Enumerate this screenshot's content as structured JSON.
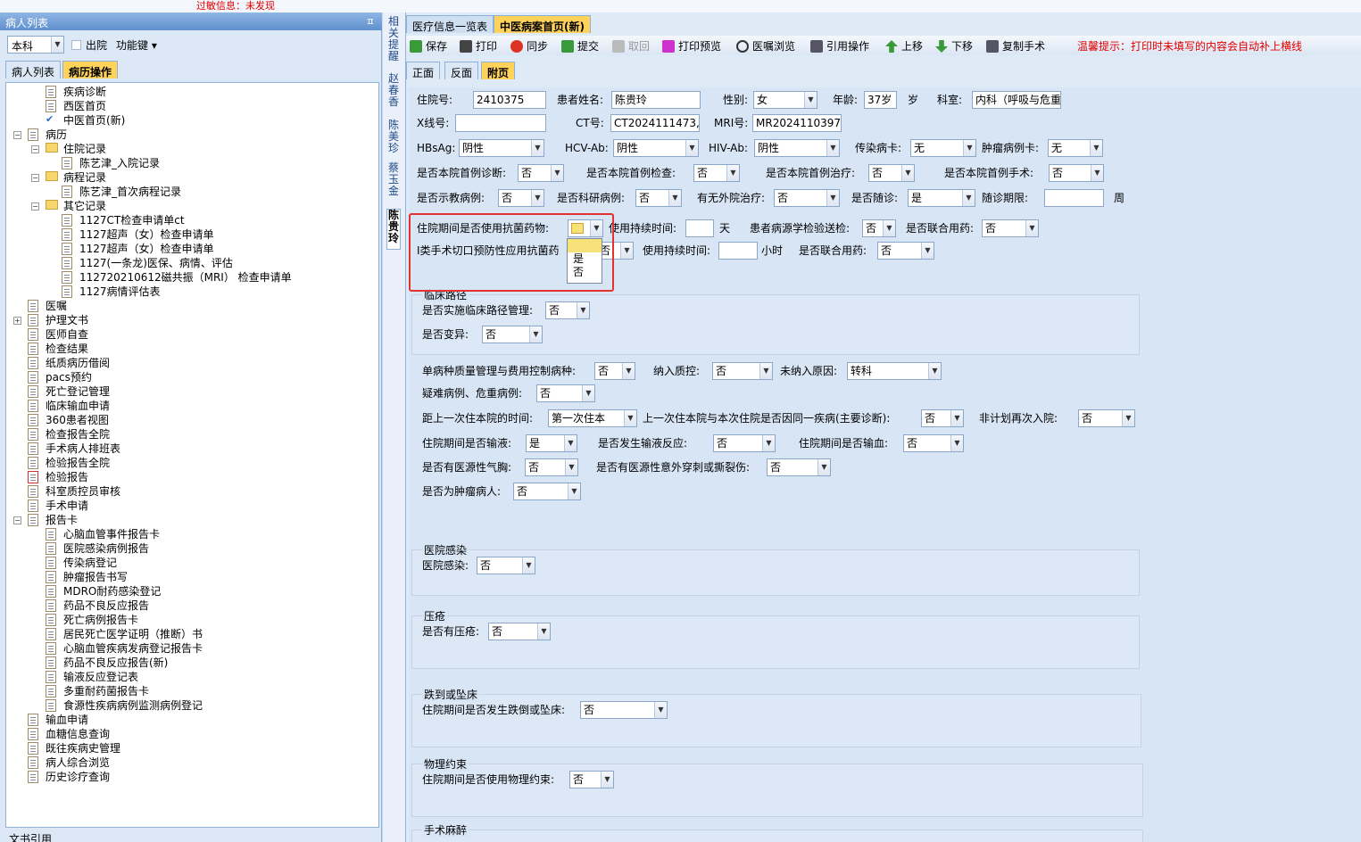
{
  "allergy": "过敏信息：未发现",
  "left": {
    "title": "病人列表",
    "pin": "ㅍ",
    "dept": "本科",
    "discharge": "出院",
    "func": "功能键 ▾",
    "tabs": [
      "病人列表",
      "病历操作"
    ],
    "tree": [
      {
        "t": "疾病诊断",
        "l": 1,
        "i": "doc"
      },
      {
        "t": "西医首页",
        "l": 1,
        "i": "doc"
      },
      {
        "t": "中医首页(新)",
        "l": 1,
        "i": "check"
      },
      {
        "t": "病历",
        "l": 0,
        "i": "doc",
        "e": "−"
      },
      {
        "t": "住院记录",
        "l": 1,
        "i": "fold",
        "e": "−"
      },
      {
        "t": "陈艺津_入院记录",
        "l": 2,
        "i": "doc"
      },
      {
        "t": "病程记录",
        "l": 1,
        "i": "fold",
        "e": "−"
      },
      {
        "t": "陈艺津_首次病程记录",
        "l": 2,
        "i": "doc"
      },
      {
        "t": "其它记录",
        "l": 1,
        "i": "fold",
        "e": "−"
      },
      {
        "t": "1127CT检查申请单ct",
        "l": 2,
        "i": "doc"
      },
      {
        "t": "1127超声（女）检查申请单",
        "l": 2,
        "i": "doc"
      },
      {
        "t": "1127超声（女）检查申请单",
        "l": 2,
        "i": "doc"
      },
      {
        "t": "1127(一条龙)医保、病情、评估",
        "l": 2,
        "i": "doc"
      },
      {
        "t": "112720210612磁共振（MRI） 检查申请单",
        "l": 2,
        "i": "doc"
      },
      {
        "t": "1127病情评估表",
        "l": 2,
        "i": "doc"
      },
      {
        "t": "医嘱",
        "l": 0,
        "i": "doc"
      },
      {
        "t": "护理文书",
        "l": 0,
        "i": "doc",
        "e": "+"
      },
      {
        "t": "医师自查",
        "l": 0,
        "i": "doc"
      },
      {
        "t": "检查结果",
        "l": 0,
        "i": "doc"
      },
      {
        "t": "纸质病历借阅",
        "l": 0,
        "i": "doc"
      },
      {
        "t": "pacs预约",
        "l": 0,
        "i": "doc"
      },
      {
        "t": "死亡登记管理",
        "l": 0,
        "i": "doc"
      },
      {
        "t": "临床输血申请",
        "l": 0,
        "i": "doc"
      },
      {
        "t": "360患者视图",
        "l": 0,
        "i": "doc"
      },
      {
        "t": "检查报告全院",
        "l": 0,
        "i": "doc"
      },
      {
        "t": "手术病人排班表",
        "l": 0,
        "i": "doc"
      },
      {
        "t": "检验报告全院",
        "l": 0,
        "i": "doc"
      },
      {
        "t": "检验报告",
        "l": 0,
        "i": "red"
      },
      {
        "t": "科室质控员审核",
        "l": 0,
        "i": "doc"
      },
      {
        "t": "手术申请",
        "l": 0,
        "i": "doc"
      },
      {
        "t": "报告卡",
        "l": 0,
        "i": "doc",
        "e": "−"
      },
      {
        "t": "心脑血管事件报告卡",
        "l": 1,
        "i": "doc"
      },
      {
        "t": "医院感染病例报告",
        "l": 1,
        "i": "doc"
      },
      {
        "t": "传染病登记",
        "l": 1,
        "i": "doc"
      },
      {
        "t": "肿瘤报告书写",
        "l": 1,
        "i": "doc"
      },
      {
        "t": "MDRO耐药感染登记",
        "l": 1,
        "i": "doc"
      },
      {
        "t": "药品不良反应报告",
        "l": 1,
        "i": "doc"
      },
      {
        "t": "死亡病例报告卡",
        "l": 1,
        "i": "doc"
      },
      {
        "t": "居民死亡医学证明（推断）书",
        "l": 1,
        "i": "doc"
      },
      {
        "t": "心脑血管疾病发病登记报告卡",
        "l": 1,
        "i": "doc"
      },
      {
        "t": "药品不良反应报告(新)",
        "l": 1,
        "i": "doc"
      },
      {
        "t": "输液反应登记表",
        "l": 1,
        "i": "doc"
      },
      {
        "t": "多重耐药菌报告卡",
        "l": 1,
        "i": "doc"
      },
      {
        "t": "食源性疾病病例监测病例登记",
        "l": 1,
        "i": "doc"
      },
      {
        "t": "输血申请",
        "l": 0,
        "i": "doc"
      },
      {
        "t": "血糖信息查询",
        "l": 0,
        "i": "doc"
      },
      {
        "t": "既往疾病史管理",
        "l": 0,
        "i": "doc"
      },
      {
        "t": "病人综合浏览",
        "l": 0,
        "i": "doc"
      },
      {
        "t": "历史诊疗查询",
        "l": 0,
        "i": "doc"
      }
    ],
    "bottom": "文书引用"
  },
  "vnames": [
    {
      "n": "相关提醒"
    },
    {
      "n": "赵春香"
    },
    {
      "n": "陈美珍"
    },
    {
      "n": "蔡玉金"
    },
    {
      "n": "陈贵玲"
    }
  ],
  "main": {
    "tabs": [
      "医疗信息一览表",
      "中医病案首页(新)"
    ],
    "toolbar": [
      "保存",
      "打印",
      "同步",
      "提交",
      "取回",
      "打印预览",
      "医嘱浏览",
      "引用操作",
      "上移",
      "下移",
      "复制手术"
    ],
    "warn": "温馨提示：打印时未填写的内容会自动补上横线",
    "subtabs": [
      "正面",
      "反面",
      "附页"
    ]
  },
  "form": {
    "l_zyh": "住院号:",
    "v_zyh": "2410375",
    "l_name": "患者姓名:",
    "v_name": "陈贵玲",
    "l_sex": "性别:",
    "v_sex": "女",
    "l_age": "年龄:",
    "v_age": "37岁",
    "l_sui": "岁",
    "l_dept": "科室:",
    "v_dept": "内科（呼吸与危重",
    "l_x": "X线号:",
    "v_x": "",
    "l_ct": "CT号:",
    "v_ct": "CT2024111473,C",
    "l_mri": "MRI号:",
    "v_mri": "MR2024110397",
    "l_hbs": "HBsAg:",
    "v_hbs": "阴性",
    "l_hcv": "HCV-Ab:",
    "v_hcv": "阴性",
    "l_hiv": "HIV-Ab:",
    "v_hiv": "阴性",
    "l_crb": "传染病卡:",
    "v_crb": "无",
    "l_zlb": "肿瘤病例卡:",
    "v_zlb": "无",
    "l_q1": "是否本院首例诊断:",
    "v_q1": "否",
    "l_q2": "是否本院首例检查:",
    "v_q2": "否",
    "l_q3": "是否本院首例治疗:",
    "v_q3": "否",
    "l_q4": "是否本院首例手术:",
    "v_q4": "否",
    "l_q5": "是否示教病例:",
    "v_q5": "否",
    "l_q6": "是否科研病例:",
    "v_q6": "否",
    "l_q7": "有无外院治疗:",
    "v_q7": "否",
    "l_q8": "是否随诊:",
    "v_q8": "是",
    "l_q9": "随诊期限:",
    "v_q9": "",
    "l_week": "周",
    "l_kj": "住院期间是否使用抗菌药物:",
    "v_kj": "",
    "l_kjt": "使用持续时间:",
    "v_kjt": "",
    "l_day": "天",
    "l_by": "患者病源学检验送检:",
    "v_by": "否",
    "l_lh": "是否联合用药:",
    "v_lh": "否",
    "l_i1": "I类手术切口预防性应用抗菌药",
    "v_i1": "否",
    "l_i2": "使用持续时间:",
    "v_i2": "",
    "l_hour": "小时",
    "l_i3": "是否联合用药:",
    "v_i3": "否",
    "popup": [
      "是",
      "否"
    ],
    "g_lclj": "临床路径",
    "l_lj1": "是否实施临床路径管理:",
    "v_lj1": "否",
    "l_lj2": "是否变异:",
    "v_lj2": "否",
    "l_dbz": "单病种质量管理与费用控制病种:",
    "v_dbz": "否",
    "l_nrzk": "纳入质控:",
    "v_nrzk": "否",
    "l_wnr": "未纳入原因:",
    "v_wnr": "转科",
    "l_yn": "疑难病例、危重病例:",
    "v_yn": "否",
    "l_jl": "距上一次住本院的时间:",
    "v_jl": "第一次住本",
    "l_tb": "上一次住本院与本次住院是否因同一疾病(主要诊断):",
    "v_tb": "否",
    "l_fjh": "非计划再次入院:",
    "v_fjh": "否",
    "l_sy": "住院期间是否输液:",
    "v_sy": "是",
    "l_syfy": "是否发生输液反应:",
    "v_syfy": "否",
    "l_sx": "住院期间是否输血:",
    "v_sx": "否",
    "l_qx": "是否有医源性气胸:",
    "v_qx": "否",
    "l_cc": "是否有医源性意外穿刺或撕裂伤:",
    "v_cc": "否",
    "l_zl": "是否为肿瘤病人:",
    "v_zl": "否",
    "g_gr": "医院感染",
    "l_gr": "医院感染:",
    "v_gr": "否",
    "g_yc": "压疮",
    "l_yc": "是否有压疮:",
    "v_yc": "否",
    "g_dd": "跌到或坠床",
    "l_dd": "住院期间是否发生跌倒或坠床:",
    "v_dd": "否",
    "g_ys": "物理约束",
    "l_ys": "住院期间是否使用物理约束:",
    "v_ys": "否",
    "g_ss": "手术麻醉"
  }
}
